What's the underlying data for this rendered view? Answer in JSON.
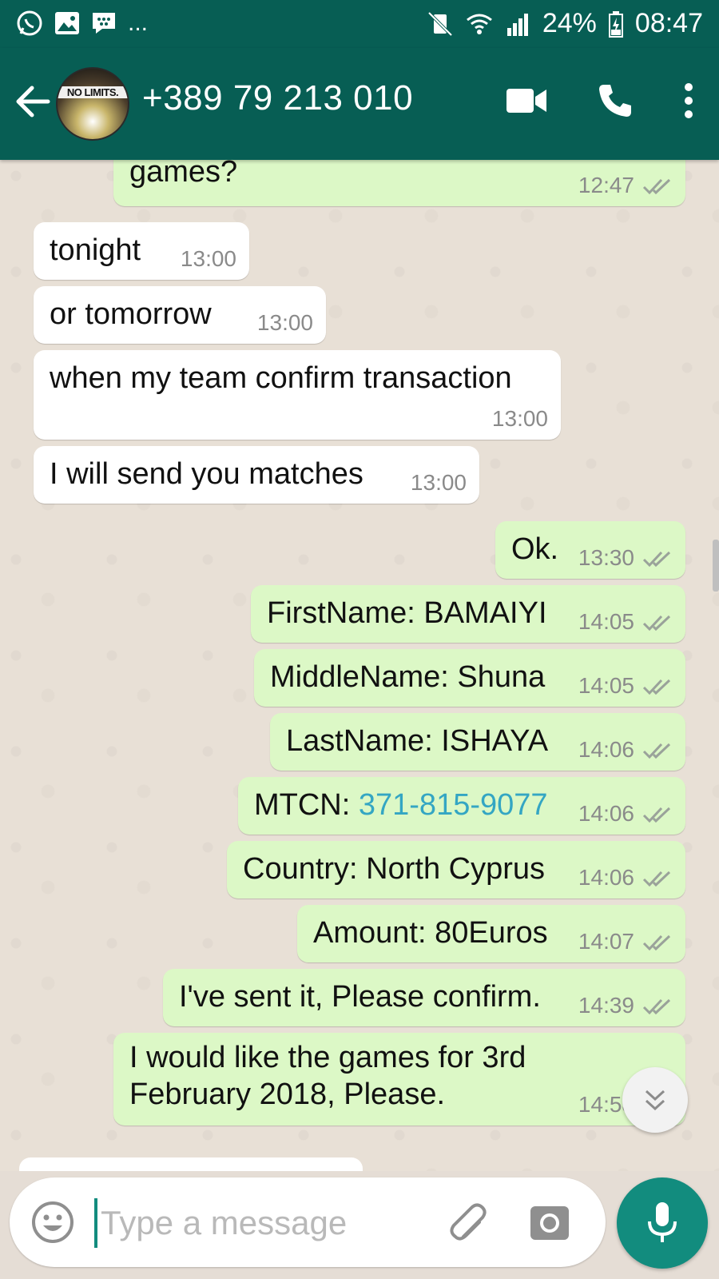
{
  "status_bar": {
    "battery": "24%",
    "time": "08:47",
    "more": "...",
    "icons": [
      "whatsapp-icon",
      "gallery-icon",
      "bbm-icon",
      "mute-icon",
      "wifi-icon",
      "signal-icon",
      "battery-icon"
    ]
  },
  "header": {
    "avatar_text": "NO LIMITS.",
    "contact": "+389 79 213 010",
    "icons": [
      "back-arrow-icon",
      "video-call-icon",
      "phone-icon",
      "more-vert-icon"
    ]
  },
  "messages": [
    {
      "dir": "out",
      "text": "games?",
      "time": "12:47",
      "ticks": true
    },
    {
      "dir": "in",
      "text": "tonight",
      "time": "13:00"
    },
    {
      "dir": "in",
      "text": "or tomorrow",
      "time": "13:00"
    },
    {
      "dir": "in",
      "text": "when my team confirm transaction",
      "time": "13:00"
    },
    {
      "dir": "in",
      "text": "I will send you matches",
      "time": "13:00"
    },
    {
      "dir": "out",
      "text": "Ok.",
      "time": "13:30",
      "ticks": true
    },
    {
      "dir": "out",
      "text": "FirstName: BAMAIYI",
      "time": "14:05",
      "ticks": true
    },
    {
      "dir": "out",
      "text": "MiddleName: Shuna",
      "time": "14:05",
      "ticks": true
    },
    {
      "dir": "out",
      "text": "LastName: ISHAYA",
      "time": "14:06",
      "ticks": true
    },
    {
      "dir": "out",
      "text_prefix": "MTCN: ",
      "link": "371-815-9077",
      "time": "14:06",
      "ticks": true
    },
    {
      "dir": "out",
      "text": "Country: North Cyprus",
      "time": "14:06",
      "ticks": true
    },
    {
      "dir": "out",
      "text": "Amount: 80Euros",
      "time": "14:07",
      "ticks": true
    },
    {
      "dir": "out",
      "text": "I've sent it, Please confirm.",
      "time": "14:39",
      "ticks": true
    },
    {
      "dir": "out",
      "line1": "I would like the games for 3rd",
      "line2": "February 2018, Please.",
      "time": "14:58",
      "ticks": true
    }
  ],
  "input": {
    "placeholder": "Type a message",
    "icons": [
      "emoji-icon",
      "attach-icon",
      "camera-icon",
      "mic-icon"
    ]
  },
  "colors": {
    "header": "#075e54",
    "outgoing_bubble": "#dcf8c6",
    "incoming_bubble": "#ffffff",
    "accent": "#128c7e",
    "link": "#34a6c3"
  }
}
